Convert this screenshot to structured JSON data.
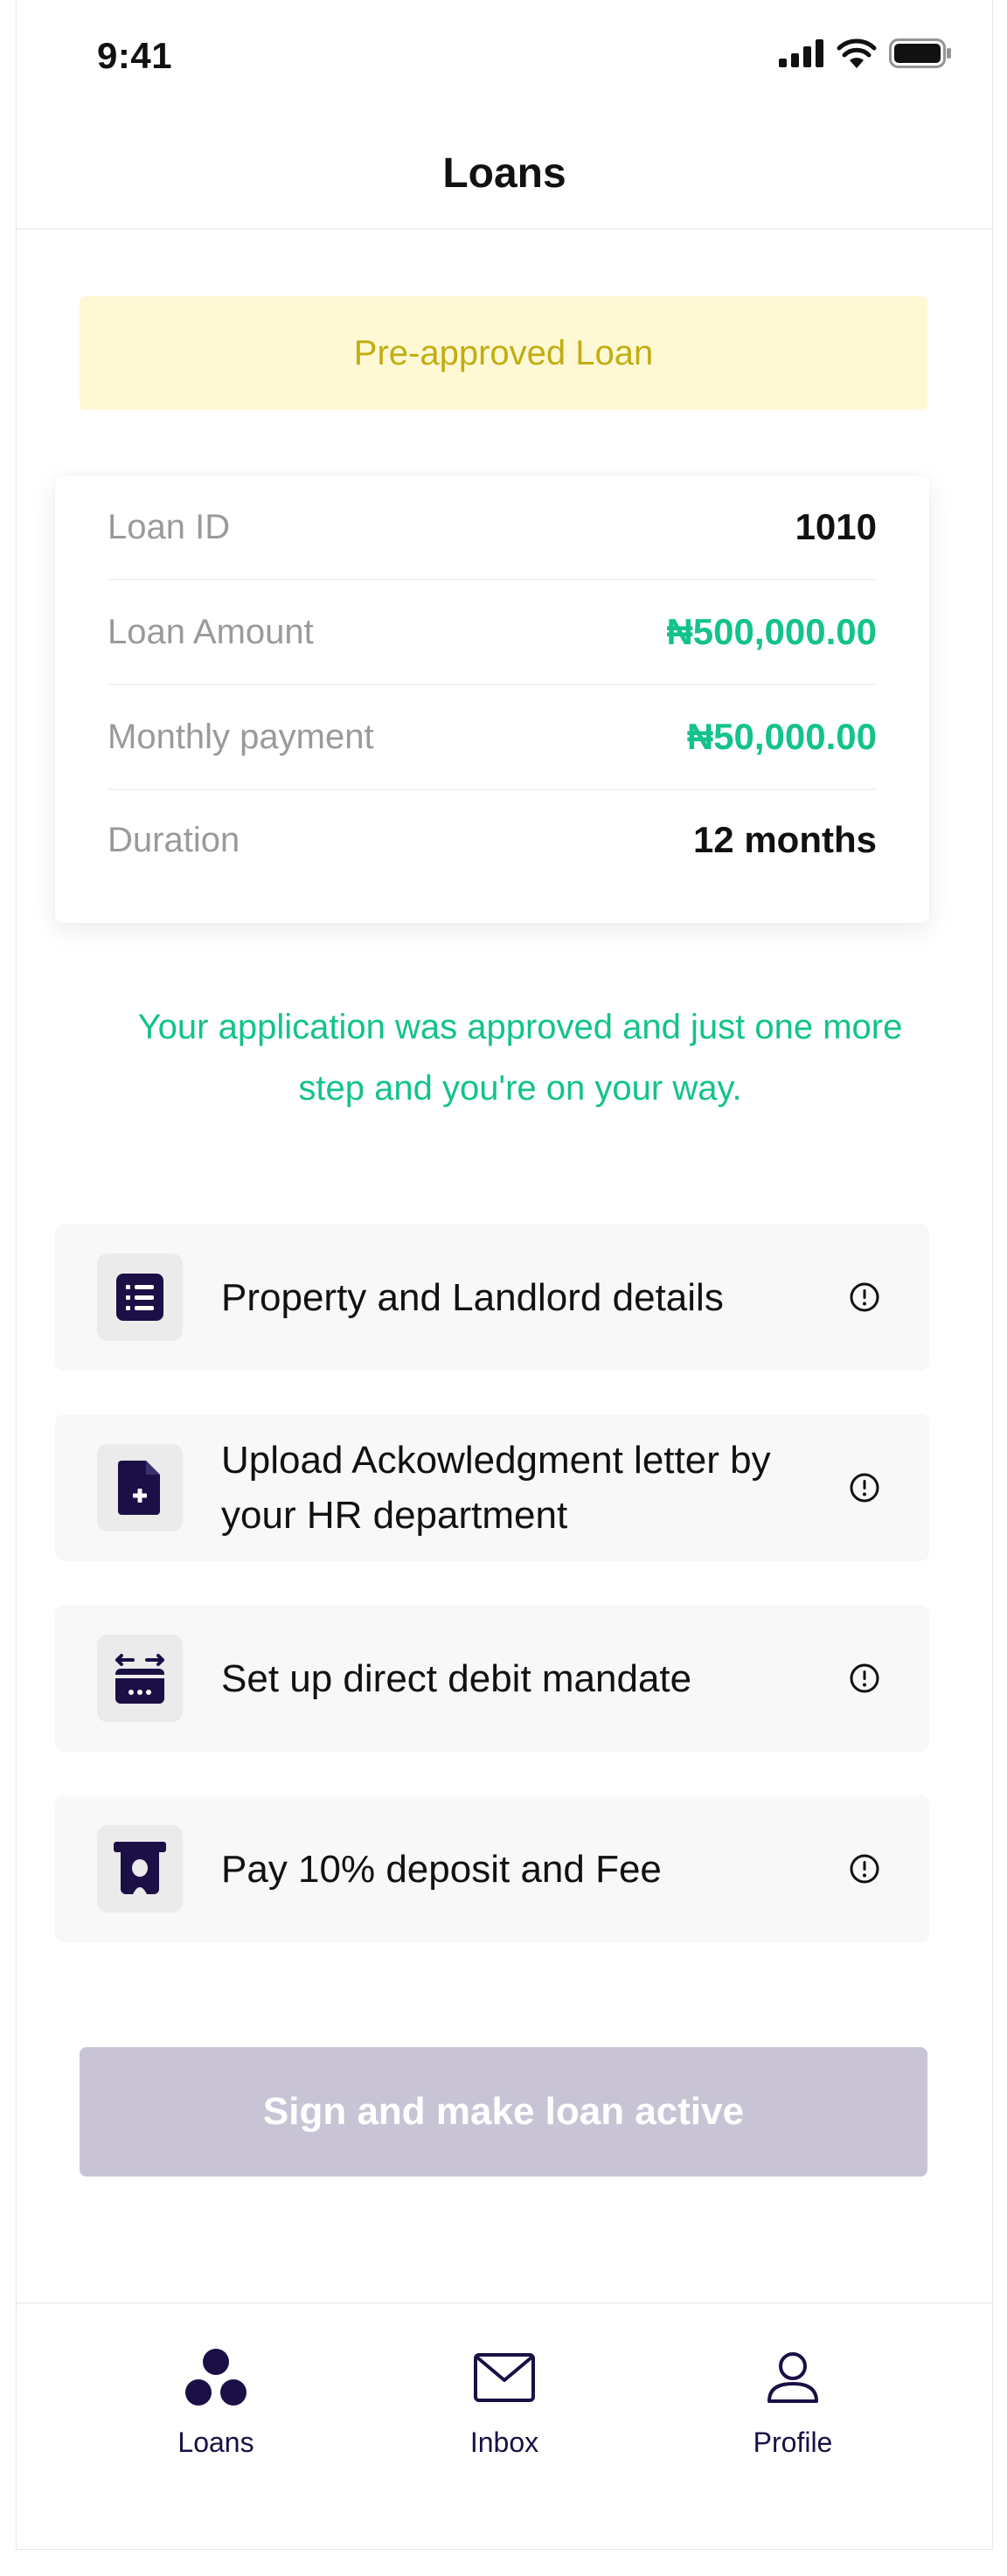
{
  "status_bar": {
    "time": "9:41"
  },
  "header": {
    "title": "Loans"
  },
  "banner": {
    "text": "Pre-approved Loan"
  },
  "loan_details": [
    {
      "label": "Loan ID",
      "value": "1010"
    },
    {
      "label": "Loan Amount",
      "value": "₦500,000.00"
    },
    {
      "label": "Monthly payment",
      "value": "₦50,000.00"
    },
    {
      "label": "Duration",
      "value": "12 months"
    }
  ],
  "approval_message": "Your application was approved and just one more step and you're on your way.",
  "steps": [
    {
      "label": "Property and Landlord details",
      "icon": "list-document-icon"
    },
    {
      "label": "Upload Ackowledgment letter by your HR department",
      "icon": "file-add-icon"
    },
    {
      "label": "Set up direct debit mandate",
      "icon": "calendar-transfer-icon"
    },
    {
      "label": "Pay 10% deposit and Fee",
      "icon": "atm-cash-icon"
    }
  ],
  "primary_action": {
    "label": "Sign and make loan active"
  },
  "tab_bar": {
    "tabs": [
      {
        "label": "Loans",
        "icon": "loans-icon",
        "active": true
      },
      {
        "label": "Inbox",
        "icon": "mail-icon",
        "active": false
      },
      {
        "label": "Profile",
        "icon": "user-icon",
        "active": false
      }
    ]
  },
  "colors": {
    "accent_green": "#13c28c",
    "banner_bg": "#fef9d4",
    "banner_text": "#c2ad11",
    "brand_dark": "#1b0f45",
    "disabled_button": "#c8c4d6"
  }
}
